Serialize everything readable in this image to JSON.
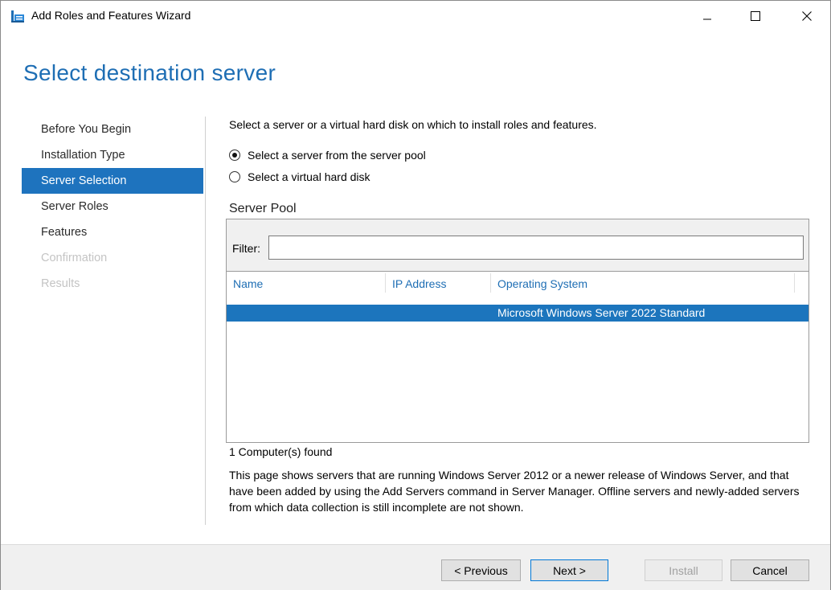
{
  "window": {
    "title": "Add Roles and Features Wizard"
  },
  "header": {
    "title": "Select destination server"
  },
  "nav": {
    "items": [
      {
        "label": "Before You Begin",
        "state": "normal"
      },
      {
        "label": "Installation Type",
        "state": "normal"
      },
      {
        "label": "Server Selection",
        "state": "selected"
      },
      {
        "label": "Server Roles",
        "state": "normal"
      },
      {
        "label": "Features",
        "state": "normal"
      },
      {
        "label": "Confirmation",
        "state": "disabled"
      },
      {
        "label": "Results",
        "state": "disabled"
      }
    ]
  },
  "content": {
    "instruction": "Select a server or a virtual hard disk on which to install roles and features.",
    "options": [
      {
        "label": "Select a server from the server pool",
        "checked": true
      },
      {
        "label": "Select a virtual hard disk",
        "checked": false
      }
    ],
    "pool_title": "Server Pool",
    "filter": {
      "label": "Filter:",
      "value": ""
    },
    "columns": [
      "Name",
      "IP Address",
      "Operating System"
    ],
    "rows": [
      {
        "name": "",
        "ip": "",
        "os": "Microsoft Windows Server 2022 Standard",
        "selected": true
      }
    ],
    "found": "1 Computer(s) found",
    "description": "This page shows servers that are running Windows Server 2012 or a newer release of Windows Server, and that have been added by using the Add Servers command in Server Manager. Offline servers and newly-added servers from which data collection is still incomplete are not shown."
  },
  "footer": {
    "previous": "< Previous",
    "next": "Next >",
    "install": "Install",
    "cancel": "Cancel"
  },
  "colors": {
    "accent": "#1e6eb4",
    "selection": "#1c75bd"
  }
}
